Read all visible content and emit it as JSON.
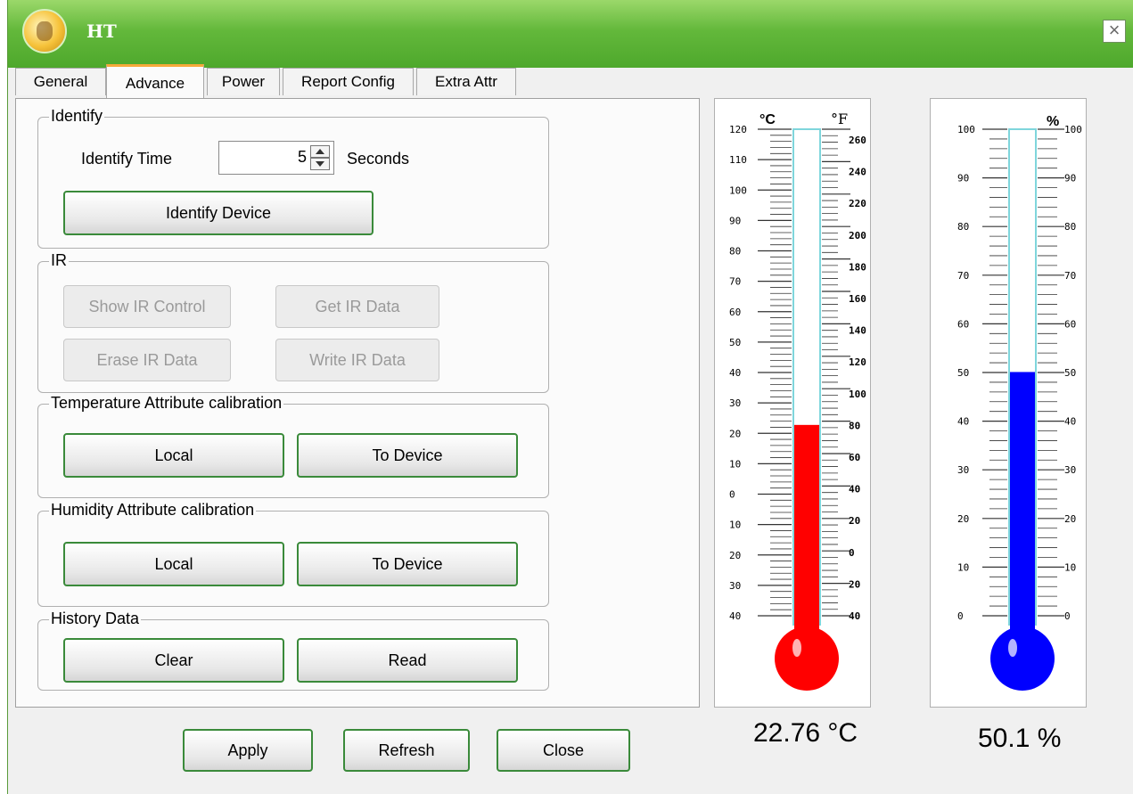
{
  "window": {
    "title": "HT",
    "close_glyph": "×"
  },
  "tabs": [
    "General",
    "Advance",
    "Power",
    "Report Config",
    "Extra Attr"
  ],
  "active_tab": "Advance",
  "identify": {
    "legend": "Identify",
    "time_label": "Identify Time",
    "time_value": "5",
    "unit": "Seconds",
    "button": "Identify Device"
  },
  "ir": {
    "legend": "IR",
    "show_control": "Show IR Control",
    "get_data": "Get IR Data",
    "erase_data": "Erase IR Data",
    "write_data": "Write IR Data"
  },
  "temperature_cal": {
    "legend": "Temperature Attribute calibration",
    "local": "Local",
    "to_device": "To Device"
  },
  "humidity_cal": {
    "legend": "Humidity Attribute calibration",
    "local": "Local",
    "to_device": "To Device"
  },
  "history": {
    "legend": "History Data",
    "clear": "Clear",
    "read": "Read"
  },
  "footer": {
    "apply": "Apply",
    "refresh": "Refresh",
    "close": "Close"
  },
  "temperature": {
    "readout": "22.76 °C",
    "value_c": 22.76,
    "unit_c": "°C",
    "unit_f": "°F",
    "scale_c": [
      "120",
      "110",
      "100",
      "90",
      "80",
      "70",
      "60",
      "50",
      "40",
      "30",
      "20",
      "10",
      "0",
      "10",
      "20",
      "30",
      "40"
    ],
    "scale_f": [
      "260",
      "240",
      "220",
      "200",
      "180",
      "160",
      "140",
      "120",
      "100",
      "80",
      "60",
      "40",
      "20",
      "0",
      "20",
      "40"
    ],
    "fill_color": "#ff0000"
  },
  "humidity": {
    "readout": "50.1 %",
    "value": 50.1,
    "unit": "%",
    "scale": [
      "100",
      "90",
      "80",
      "70",
      "60",
      "50",
      "40",
      "30",
      "20",
      "10",
      "0"
    ],
    "fill_color": "#0000ff"
  }
}
